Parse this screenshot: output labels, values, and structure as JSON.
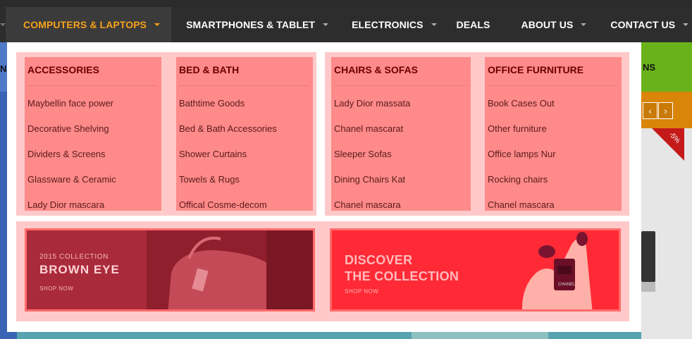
{
  "background": {
    "left_fragment": "N",
    "right_fragment": "NS",
    "discount_badge": "-5%",
    "prev_arrow": "‹",
    "next_arrow": "›"
  },
  "nav": {
    "items": [
      {
        "label": "COMPUTERS & LAPTOPS",
        "active": true,
        "has_dropdown": true
      },
      {
        "label": "SMARTPHONES & TABLET",
        "active": false,
        "has_dropdown": true
      },
      {
        "label": "ELECTRONICS",
        "active": false,
        "has_dropdown": true
      },
      {
        "label": "DEALS",
        "active": false,
        "has_dropdown": false
      },
      {
        "label": "ABOUT US",
        "active": false,
        "has_dropdown": true
      },
      {
        "label": "CONTACT US",
        "active": false,
        "has_dropdown": true
      }
    ]
  },
  "mega_menu": {
    "columns": [
      {
        "title": "ACCESSORIES",
        "links": [
          "Maybellin face power",
          "Decorative Shelving",
          "Dividers & Screens",
          "Glassware & Ceramic",
          "Lady Dior mascara"
        ]
      },
      {
        "title": "BED & BATH",
        "links": [
          "Bathtime Goods",
          "Bed & Bath Accessories",
          "Shower Curtains",
          "Towels & Rugs",
          "Offical Cosme-decom"
        ]
      },
      {
        "title": "CHAIRS & SOFAS",
        "links": [
          "Lady Dior massata",
          "Chanel mascarat",
          "Sleeper Sofas",
          "Dining Chairs Kat",
          "Chanel mascara"
        ]
      },
      {
        "title": "OFFICE FURNITURE",
        "links": [
          "Book Cases Out",
          "Other furniture",
          "Office lamps Nur",
          "Rocking chairs",
          "Chanel mascara"
        ]
      }
    ],
    "banners": [
      {
        "small": "2015 COLLECTION",
        "big": "BROWN EYE",
        "cta": "SHOP NOW"
      },
      {
        "big_line1": "DISCOVER",
        "big_line2": "THE COLLECTION",
        "cta": "SHOP NOW",
        "product_label": "CHANEL"
      }
    ]
  },
  "colors": {
    "nav_bg": "#2d2d2d",
    "nav_active_text": "#f7a21b",
    "highlight_group": "#ffc9c9",
    "highlight_column": "#ff8a8a"
  }
}
